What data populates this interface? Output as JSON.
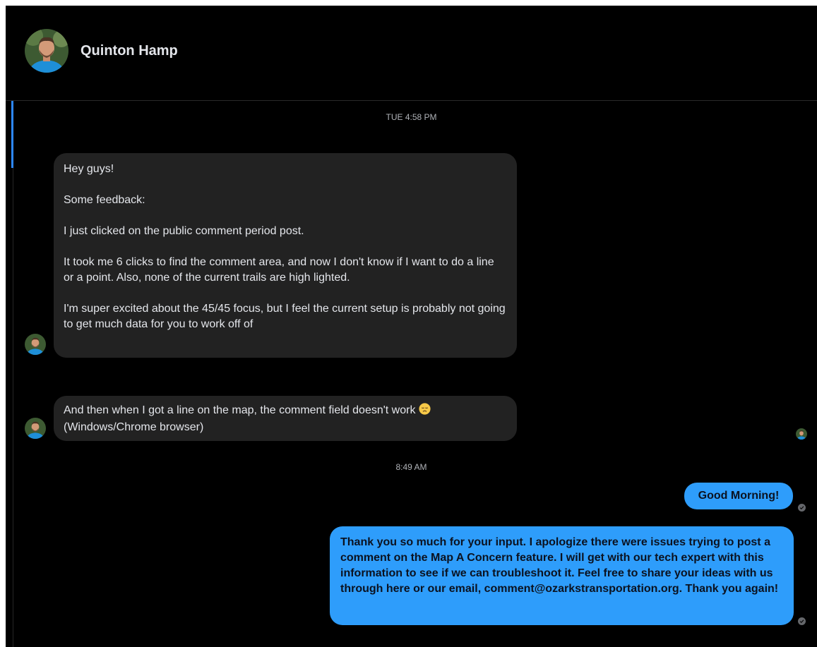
{
  "contact": {
    "name": "Quinton Hamp",
    "avatar_icon": "profile-photo"
  },
  "thread": {
    "timestamp_1": "TUE 4:58 PM",
    "timestamp_2": "8:49 AM",
    "incoming": [
      {
        "paragraphs": [
          "Hey guys!",
          "Some feedback:",
          "I just clicked on the public comment period post.",
          "It took me 6 clicks to find the comment area, and now I don't know if I want to do a line or a point. Also, none of the current trails are high lighted.",
          "I'm super excited about the 45/45 focus, but I feel the current setup is probably not going to get much data for you to work off of"
        ]
      },
      {
        "line1": "And then when I got a line on the map, the comment field doesn't work",
        "emoji": "disappointed-face-emoji",
        "line2": "(Windows/Chrome browser)"
      }
    ],
    "outgoing": [
      {
        "text": "Good Morning!"
      },
      {
        "text": "Thank you so much for your input.  I apologize there were issues trying to post a comment on the Map A Concern feature.  I will get with our tech expert with this information to see if we can troubleshoot it.  Feel free to share your ideas with us through here or our email, comment@ozarkstransportation.org.  Thank you again!"
      }
    ]
  },
  "colors": {
    "background": "#000000",
    "incoming_bubble": "#222222",
    "outgoing_bubble": "#2e9dfb",
    "accent": "#2d88ff"
  }
}
